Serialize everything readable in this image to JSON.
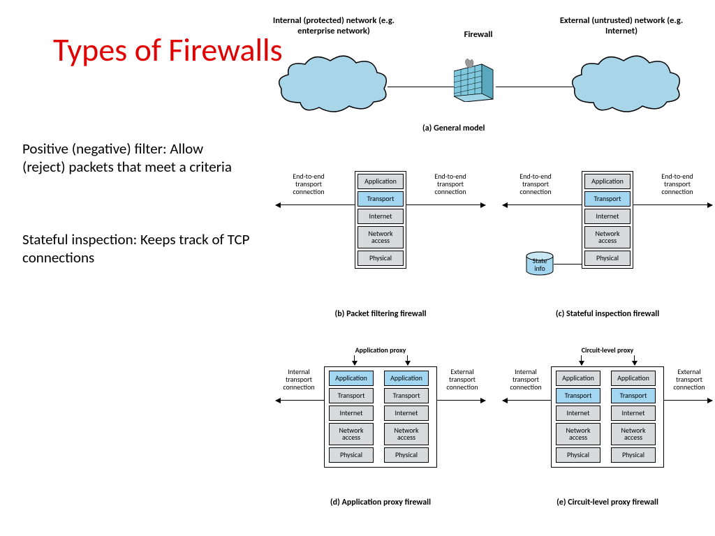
{
  "title": "Types of Firewalls",
  "sub1": "Positive (negative) filter: Allow (reject) packets that meet a criteria",
  "sub2": "Stateful inspection: Keeps track of TCP connections",
  "a": {
    "left": "Internal (protected) network (e.g. enterprise network)",
    "mid": "Firewall",
    "right": "External (untrusted) network (e.g. Internet)",
    "caption": "(a) General model"
  },
  "layers": {
    "app": "Application",
    "tr": "Transport",
    "in": "Internet",
    "na": "Network access",
    "ph": "Physical"
  },
  "conn": {
    "e2e": "End-to-end transport connection",
    "int": "Internal transport connection",
    "ext": "External transport connection"
  },
  "state": "State info",
  "b_caption": "(b) Packet filtering firewall",
  "c_caption": "(c) Stateful inspection firewall",
  "d_caption": "(d) Application proxy firewall",
  "e_caption": "(e) Circuit-level proxy firewall",
  "d_proxy": "Application proxy",
  "e_proxy": "Circuit-level proxy"
}
